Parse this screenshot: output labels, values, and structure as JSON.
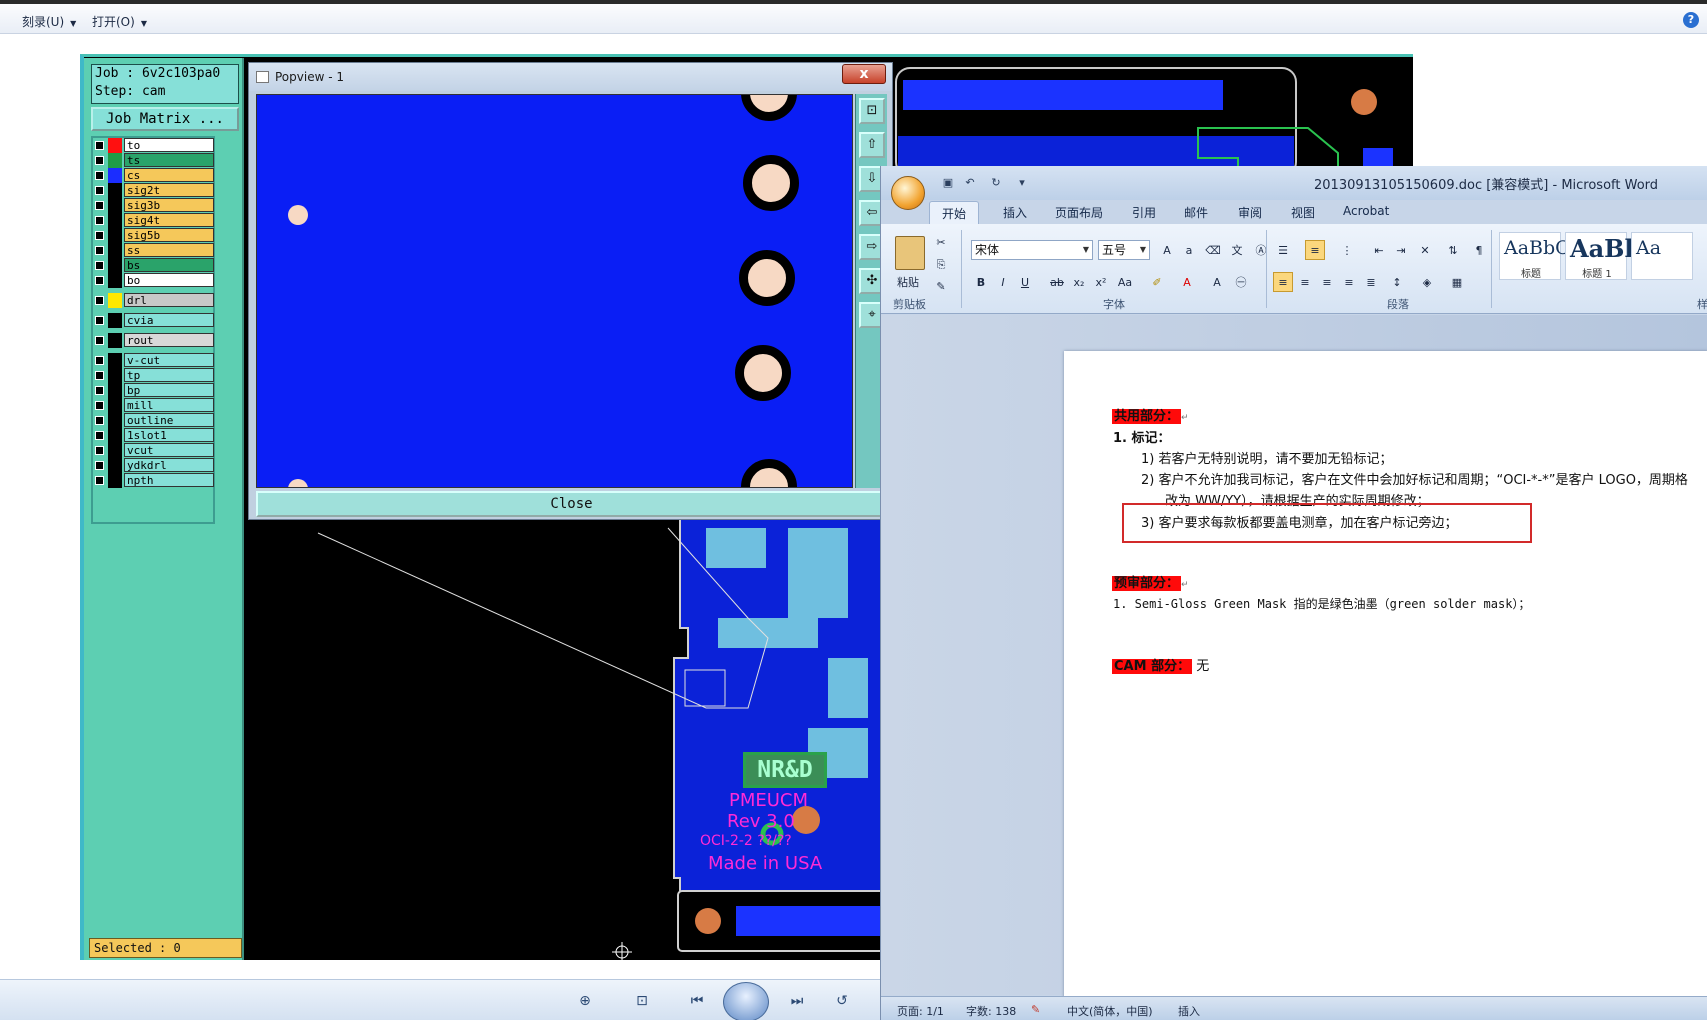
{
  "viewer": {
    "menu_burn": "刻录(U)",
    "menu_open": "打开(O)",
    "help": "?"
  },
  "cam": {
    "job_line": "Job : 6v2c103pa0",
    "step_line": "Step: cam",
    "job_matrix": "Job Matrix ...",
    "selected": "Selected : 0",
    "layers": [
      {
        "name": "to",
        "color": "#ff1010",
        "bg": "#ffffff"
      },
      {
        "name": "ts",
        "color": "#1f9c46",
        "bg": "#2aa36a"
      },
      {
        "name": "cs",
        "color": "#1b2dff",
        "bg": "#f5c85a"
      },
      {
        "name": "sig2t",
        "color": "#000000",
        "bg": "#f5c85a"
      },
      {
        "name": "sig3b",
        "color": "#000000",
        "bg": "#f5c85a"
      },
      {
        "name": "sig4t",
        "color": "#000000",
        "bg": "#f5c85a"
      },
      {
        "name": "sig5b",
        "color": "#000000",
        "bg": "#f5c85a"
      },
      {
        "name": "ss",
        "color": "#000000",
        "bg": "#f5c85a"
      },
      {
        "name": "bs",
        "color": "#000000",
        "bg": "#2aa36a"
      },
      {
        "name": "bo",
        "color": "#000000",
        "bg": "#ffffff"
      },
      {
        "name": "drl",
        "color": "#ffe800",
        "bg": "#c8c8c8"
      },
      {
        "name": "cvia",
        "color": "#000000",
        "bg": "#86e0d8"
      },
      {
        "name": "rout",
        "color": "#000000",
        "bg": "#d8d8d8"
      },
      {
        "name": "v-cut",
        "color": "#000000",
        "bg": "#86e0d8"
      },
      {
        "name": "tp",
        "color": "#000000",
        "bg": "#86e0d8"
      },
      {
        "name": "bp",
        "color": "#000000",
        "bg": "#86e0d8"
      },
      {
        "name": "mill",
        "color": "#000000",
        "bg": "#86e0d8"
      },
      {
        "name": "outline",
        "color": "#000000",
        "bg": "#86e0d8"
      },
      {
        "name": "1slot1",
        "color": "#000000",
        "bg": "#86e0d8"
      },
      {
        "name": "vcut",
        "color": "#000000",
        "bg": "#86e0d8"
      },
      {
        "name": "ydkdrl",
        "color": "#000000",
        "bg": "#86e0d8"
      },
      {
        "name": "npth",
        "color": "#000000",
        "bg": "#86e0d8"
      }
    ],
    "board_label": "NR&D",
    "board_text_1": "PMEUCM",
    "board_text_2": "Rev 3.0",
    "board_text_3": "OCI-2-2 ??/??",
    "board_text_4": "Made in USA"
  },
  "popview": {
    "title": "Popview - 1",
    "close_label": "Close",
    "close_x": "x"
  },
  "word": {
    "title": "20130913105150609.doc [兼容模式] - Microsoft Word",
    "tabs": [
      "开始",
      "插入",
      "页面布局",
      "引用",
      "邮件",
      "审阅",
      "视图",
      "Acrobat"
    ],
    "paste_label": "粘贴",
    "font_name": "宋体",
    "font_size": "五号",
    "group_clipboard": "剪贴板",
    "group_font": "字体",
    "group_paragraph": "段落",
    "style_1_sample": "AaBbC",
    "style_1_name": "标题",
    "style_2_sample": "AaBl",
    "style_2_name": "标题 1",
    "style_3_sample": "Aa",
    "group_styles_partial": "样",
    "doc": {
      "h_common": "共用部分：",
      "item1": "1.  标记：",
      "item1_1": "1)  若客户无特别说明，请不要加无铅标记；",
      "item1_2": "2)  客户不允许加我司标记，客户在文件中会加好标记和周期；“OCI-*-*”是客户 LOGO，周期格",
      "item1_2b": "改为 WW/YY），请根据生产的实际周期修改；",
      "item1_3": "3)  客户要求每款板都要盖电测章，加在客户标记旁边；",
      "h_precheck": "预审部分：",
      "pre1": "1.  Semi-Gloss Green Mask 指的是绿色油墨（green solder mask）；",
      "h_cam": "CAM 部分：",
      "cam_none": "无"
    },
    "status_page": "页面: 1/1",
    "status_words": "字数: 138",
    "status_lang": "中文(简体，中国)",
    "status_insert": "插入"
  },
  "colors": {
    "cam_panel": "#5dcfb2",
    "pcb_blue": "#0a1ef5",
    "highlight_red": "#ff0a0a"
  }
}
